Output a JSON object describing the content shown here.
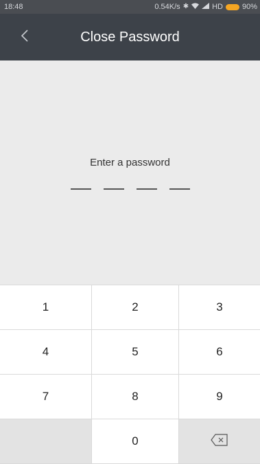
{
  "status_bar": {
    "time": "18:48",
    "network_speed": "0.54K/s",
    "hd_label": "HD",
    "battery": "90%",
    "icons": [
      "bluetooth-icon",
      "wifi-icon",
      "signal-icon",
      "battery-icon"
    ],
    "battery_color": "#f5a623"
  },
  "header": {
    "title": "Close Password",
    "back_icon": "chevron-left-icon",
    "background": "#3d4249"
  },
  "main": {
    "prompt": "Enter a password",
    "pin_length": 4
  },
  "keypad": {
    "keys": [
      "1",
      "2",
      "3",
      "4",
      "5",
      "6",
      "7",
      "8",
      "9",
      "",
      "0"
    ],
    "delete_icon": "backspace-icon"
  }
}
